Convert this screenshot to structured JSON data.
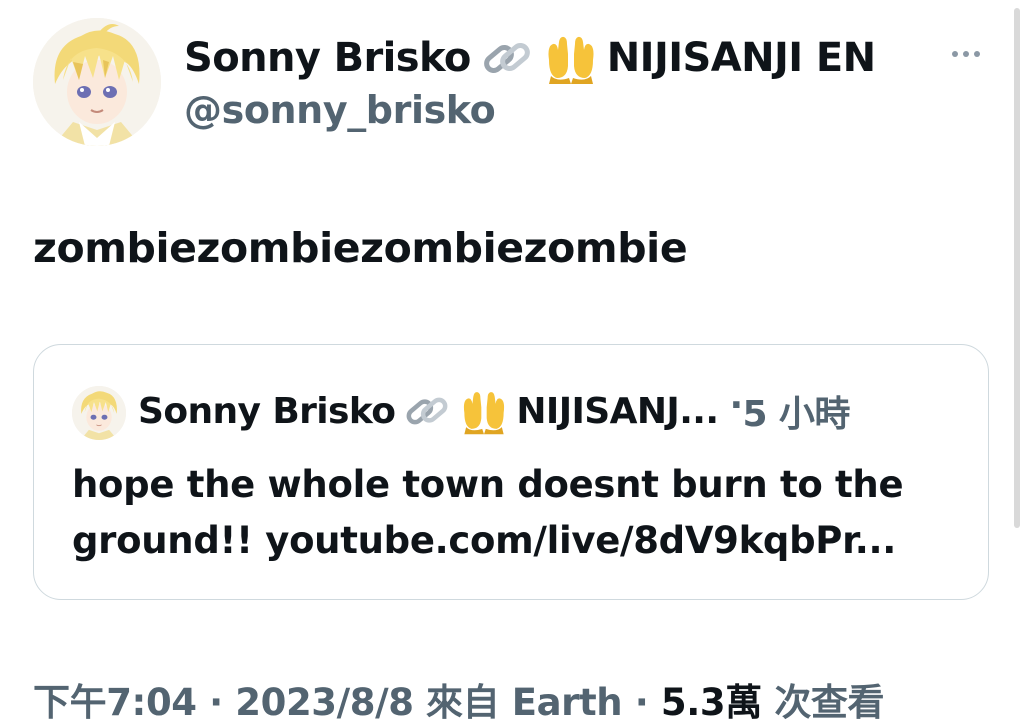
{
  "tweet": {
    "author": {
      "display_name": "Sonny Brisko",
      "emoji_1": "link-emoji",
      "emoji_2": "palms-up-emoji",
      "affiliation": "NIJISANJI EN",
      "handle": "@sonny_brisko"
    },
    "text": "zombiezombiezombiezombie",
    "quoted": {
      "display_name": "Sonny Brisko",
      "affiliation": "NIJISANJ...",
      "separator": "·",
      "time_ago": "5 小時",
      "text_line_1": "hope the whole town doesnt burn to the",
      "text_line_2": "ground!! youtube.com/live/8dV9kqbPr..."
    },
    "meta": {
      "time": "下午7:04",
      "sep_1": " · ",
      "date": "2023/8/8",
      "source_prefix": " 來自 ",
      "source": "Earth",
      "sep_2": " · ",
      "views_count": "5.3萬",
      "views_label": " 次查看"
    }
  },
  "colors": {
    "text_primary": "#0f1419",
    "text_secondary": "#536471",
    "border": "#cfd9de"
  }
}
